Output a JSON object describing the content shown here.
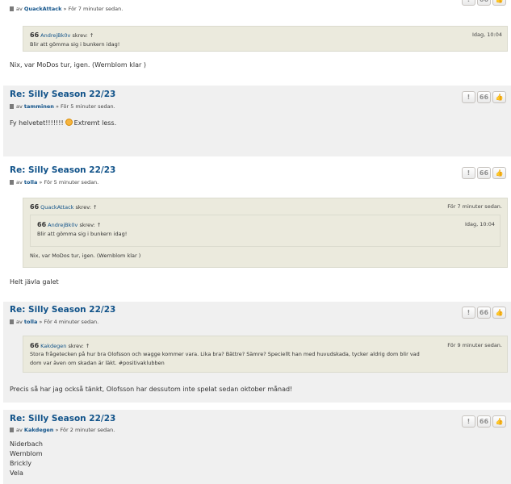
{
  "posts": [
    {
      "meta_prefix": "av",
      "author": "QuackAttack",
      "time": "» För 7 minuter sedan.",
      "quote": {
        "author": "AndrejBk0v",
        "wrote": "skrev: ↑",
        "time": "Idag, 10:04",
        "text": "Blir att gömma sig i bunkern idag!"
      },
      "body": "Nix, var MoDos tur, igen. (Wernblom klar )"
    },
    {
      "title": "Re: Silly Season 22/23",
      "meta_prefix": "av",
      "author": "tamminen",
      "time": "» För 5 minuter sedan.",
      "body_pre": "Fy helvetet!!!!!!!",
      "body_post": "Extremt less."
    },
    {
      "title": "Re: Silly Season 22/23",
      "meta_prefix": "av",
      "author": "tolla",
      "time": "» För 5 minuter sedan.",
      "quote": {
        "author": "QuackAttack",
        "wrote": "skrev: ↑",
        "time": "För 7 minuter sedan.",
        "inner": {
          "author": "AndrejBk0v",
          "wrote": "skrev: ↑",
          "time": "Idag, 10:04",
          "text": "Blir att gömma sig i bunkern idag!"
        },
        "text": "Nix, var MoDos tur, igen. (Wernblom klar )"
      },
      "body": "Helt jävla galet"
    },
    {
      "title": "Re: Silly Season 22/23",
      "meta_prefix": "av",
      "author": "tolla",
      "time": "» För 4 minuter sedan.",
      "quote": {
        "author": "Kakdegen",
        "wrote": "skrev: ↑",
        "time": "För 9 minuter sedan.",
        "line1": "Stora frågetecken på hur bra Olofsson och wagge kommer vara. Lika bra? Bättre? Sämre? Speciellt han med huvudskada, tycker aldrig dom blir vad",
        "line2": "dom var även om skadan är läkt. #positivaklubben"
      },
      "body": "Precis så har jag också tänkt, Olofsson har dessutom inte spelat sedan oktober månad!"
    },
    {
      "title": "Re: Silly Season 22/23",
      "meta_prefix": "av",
      "author": "Kakdegen",
      "time": "» För 2 minuter sedan.",
      "lines": [
        "Niderbach",
        "Wernblom",
        "Brickly",
        "Vela"
      ]
    }
  ],
  "buttons": {
    "report": "!",
    "quote": "66",
    "like": "👍"
  },
  "quote_mark": "66"
}
